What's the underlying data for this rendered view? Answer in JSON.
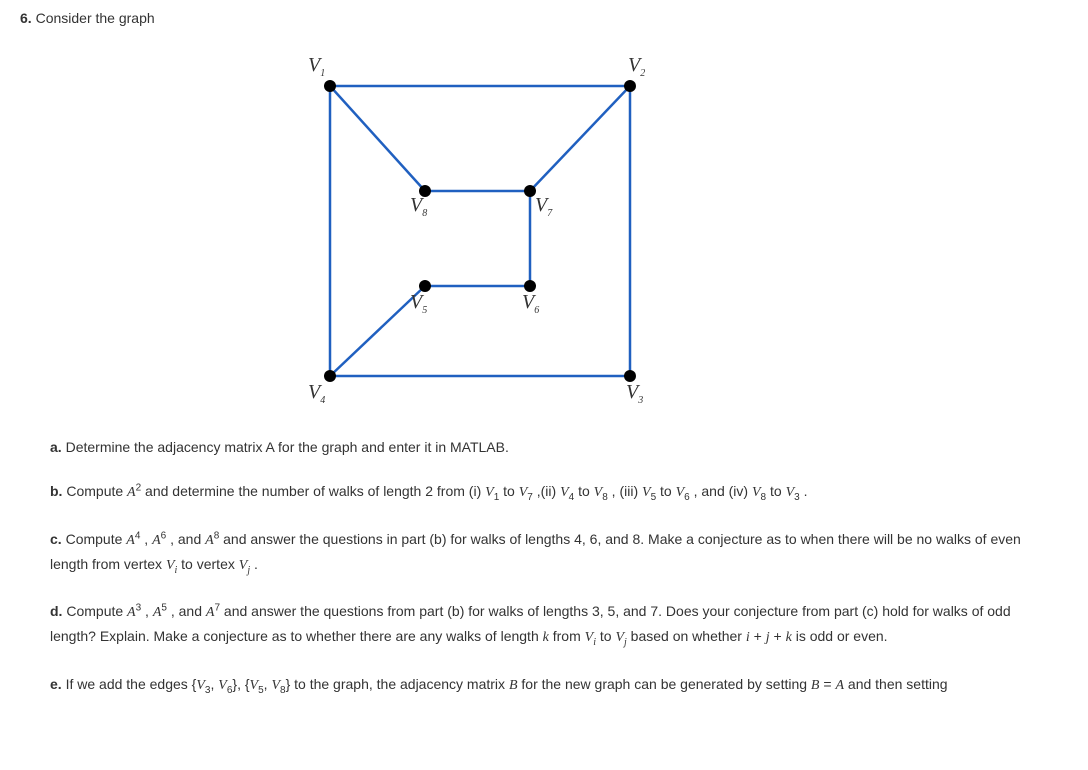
{
  "problem_number": "6.",
  "problem_title": "Consider the graph",
  "vertices": {
    "V1": "V",
    "V1_sub": "1",
    "V2": "V",
    "V2_sub": "2",
    "V3": "V",
    "V3_sub": "3",
    "V4": "V",
    "V4_sub": "4",
    "V5": "V",
    "V5_sub": "5",
    "V6": "V",
    "V6_sub": "6",
    "V7": "V",
    "V7_sub": "7",
    "V8": "V",
    "V8_sub": "8"
  },
  "questions": {
    "a": {
      "label": "a.",
      "text": "Determine the adjacency matrix A for the graph and enter it in MATLAB."
    },
    "b": {
      "label": "b.",
      "text_before": "Compute ",
      "text_after": " and determine the number of walks of length 2 from (i) ",
      "text_2": " to ",
      "text_3": " ,(ii) ",
      "text_4": " to ",
      "text_5": " , (iii) ",
      "text_6": " to ",
      "text_7": " , and (iv) ",
      "text_8": " to ",
      "text_9": " ."
    },
    "c": {
      "label": "c.",
      "text_1": "Compute ",
      "text_2": " , ",
      "text_3": " , and ",
      "text_4": " and answer the questions in part (b) for walks of lengths 4, 6, and 8. Make a conjecture as to when there will be no walks of even length from vertex ",
      "text_5": " to vertex ",
      "text_6": " ."
    },
    "d": {
      "label": "d.",
      "text_1": "Compute ",
      "text_2": " , ",
      "text_3": " , and ",
      "text_4": " and answer the questions from part (b) for walks of lengths 3, 5, and 7. Does your conjecture from part (c) hold for walks of odd length? Explain. Make a conjecture as to whether there are any walks of length ",
      "text_5": " from ",
      "text_6": " to ",
      "text_7": " based on whether ",
      "text_8": " is odd or even."
    },
    "e": {
      "label": "e.",
      "text_1": "If we add the edges ",
      "text_2": " to the graph, the adjacency matrix ",
      "text_3": " for the new graph can be generated by setting ",
      "text_4": " and then setting"
    }
  }
}
